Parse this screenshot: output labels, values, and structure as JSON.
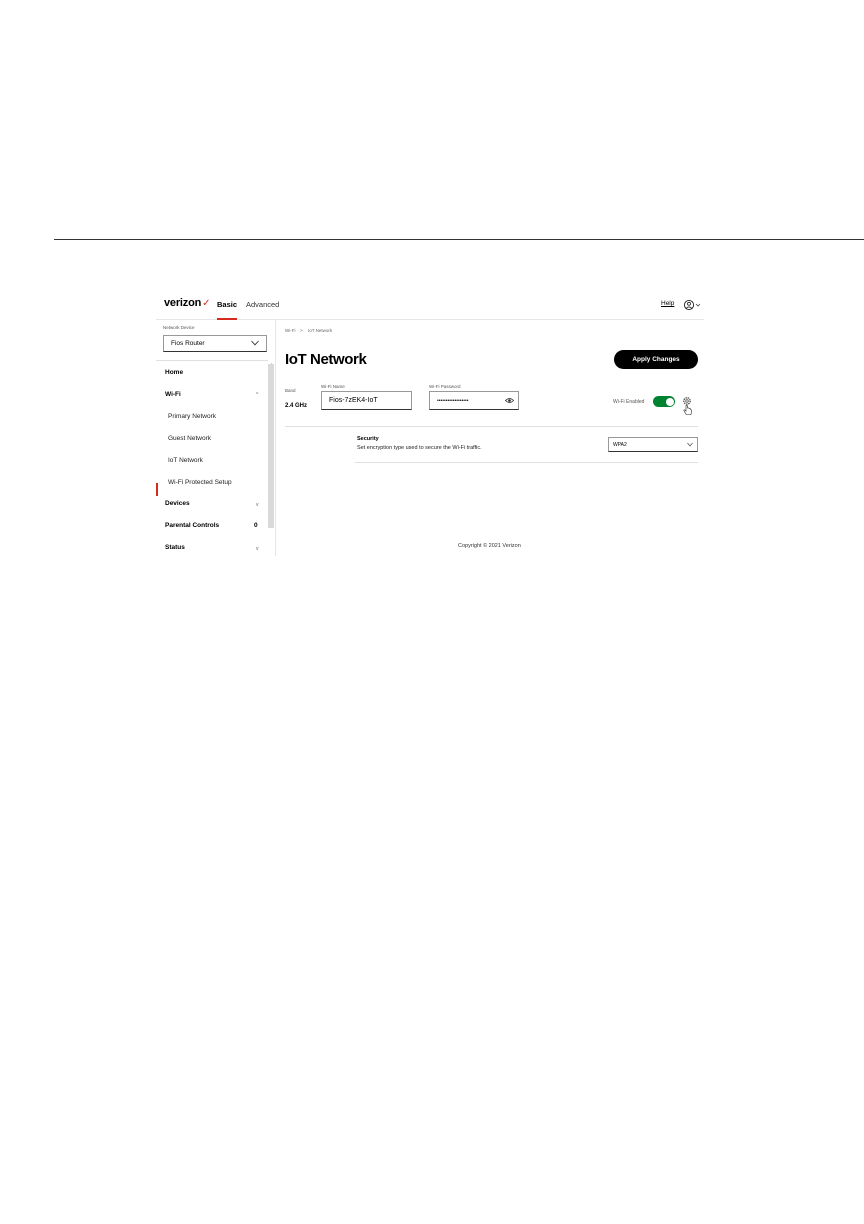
{
  "header": {
    "logo": "verizon",
    "logo_mark": "✓",
    "tabs": [
      {
        "label": "Basic",
        "active": true
      },
      {
        "label": "Advanced",
        "active": false
      }
    ],
    "help_label": "Help",
    "account_icon": "user-circle-icon"
  },
  "sidebar": {
    "network_device_label": "Network Device",
    "network_device_value": "Fios Router",
    "items": [
      {
        "label": "Home"
      },
      {
        "label": "Wi-Fi",
        "chevron": "^"
      },
      {
        "label": "Primary Network"
      },
      {
        "label": "Guest Network"
      },
      {
        "label": "IoT Network",
        "active": true
      },
      {
        "label": "Wi-Fi Protected Setup"
      },
      {
        "label": "Devices",
        "chevron": "v"
      },
      {
        "label": "Parental Controls",
        "badge": "0"
      },
      {
        "label": "Status",
        "chevron": "v"
      }
    ]
  },
  "breadcrumb": {
    "parent": "Wi-Fi",
    "separator": ">",
    "current": "IoT Network"
  },
  "main": {
    "title": "IoT Network",
    "apply_label": "Apply Changes",
    "band_label": "Band",
    "band_value": "2.4 GHz",
    "wifi_name_label": "Wi-Fi Name",
    "wifi_name_value": "Fios-7zEK4-IoT",
    "wifi_password_label": "Wi-Fi Password",
    "wifi_password_value": "••••••••••••••••••",
    "wifi_enabled_label": "Wi-Fi Enabled",
    "wifi_enabled": true,
    "security_title": "Security",
    "security_desc": "Set encryption type used to secure the Wi-Fi traffic.",
    "security_value": "WPA2"
  },
  "footer": {
    "copyright": "Copyright © 2021 Verizon"
  },
  "colors": {
    "accent": "#d52b1e",
    "toggle_on": "#008331",
    "button": "#000000"
  }
}
